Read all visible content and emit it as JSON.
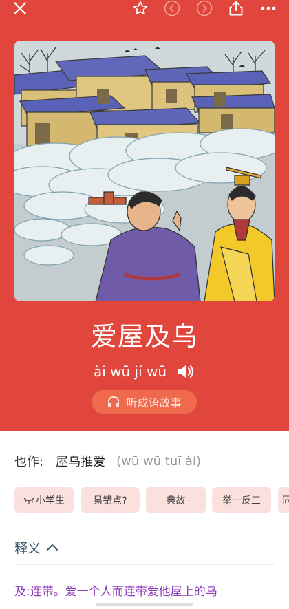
{
  "toolbar": {
    "close_icon": "close-icon",
    "star_icon": "star-outline-icon",
    "prev_icon": "circle-chevron-left-icon",
    "next_icon": "circle-chevron-right-icon",
    "share_icon": "share-icon",
    "more_icon": "more-horizontal-icon"
  },
  "idiom": {
    "title": "爱屋及乌",
    "pinyin": "ài wū jí wū",
    "speaker_icon": "speaker-icon",
    "story_button": "听成语故事",
    "headphones_icon": "headphones-icon"
  },
  "alias": {
    "label": "也作:",
    "value": "屋乌推爱",
    "pinyin": "(wū wū tuī ài)"
  },
  "tags": [
    "小学生",
    "易错点?",
    "典故",
    "举一反三",
    "同"
  ],
  "section": {
    "title": "释义",
    "toggle_icon": "chevron-up-icon"
  },
  "definition": {
    "text": "及:连带。爱一个人而连带爱他屋上的乌"
  },
  "colors": {
    "hero": "#e0463c",
    "story_button": "#ef6a4c",
    "tag_bg": "#fbe1de",
    "section_title": "#3a5b6a",
    "definition": "#8c3bb6"
  }
}
